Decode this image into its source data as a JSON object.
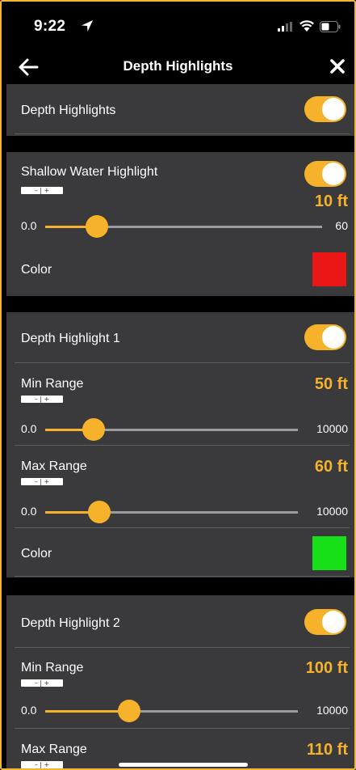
{
  "status_bar": {
    "time": "9:22"
  },
  "nav": {
    "title": "Depth Highlights"
  },
  "master": {
    "label": "Depth Highlights",
    "enabled": true
  },
  "shallow": {
    "label": "Shallow Water Highlight",
    "enabled": true,
    "value": "10 ft",
    "slider": {
      "min": "0.0",
      "max": "60",
      "level": 0.167
    },
    "color_label": "Color",
    "color": "#ea1515"
  },
  "highlight1": {
    "label": "Depth Highlight 1",
    "enabled": true,
    "min_range": {
      "label": "Min Range",
      "value": "50 ft",
      "slider": {
        "min": "0.0",
        "max": "10000",
        "level": 0.18
      }
    },
    "max_range": {
      "label": "Max Range",
      "value": "60 ft",
      "slider": {
        "min": "0.0",
        "max": "10000",
        "level": 0.2
      }
    },
    "color_label": "Color",
    "color": "#18e018"
  },
  "highlight2": {
    "label": "Depth Highlight 2",
    "enabled": true,
    "min_range": {
      "label": "Min Range",
      "value": "100 ft",
      "slider": {
        "min": "0.0",
        "max": "10000",
        "level": 0.3
      }
    },
    "max_range": {
      "label": "Max Range",
      "value": "110 ft"
    }
  },
  "stepper_text": "– | +",
  "accent_color": "#f5b22a"
}
